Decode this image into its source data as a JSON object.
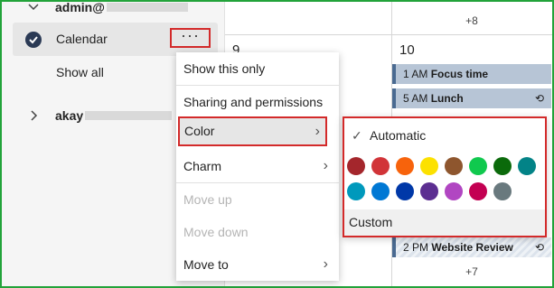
{
  "sidebar": {
    "account1": "admin@",
    "calendar_label": "Calendar",
    "more_label": "···",
    "show_all": "Show all",
    "account2": "akay"
  },
  "grid": {
    "more_top": "+8",
    "day_left": "9",
    "day_right": "10",
    "more_bottom": "+7",
    "events": [
      {
        "time": "1 AM",
        "title": "Focus time",
        "repeat": ""
      },
      {
        "time": "5 AM",
        "title": "Lunch",
        "repeat": "⟲"
      },
      {
        "time": "2 PM",
        "title": "Website Review",
        "repeat": "⟲"
      }
    ]
  },
  "menu": {
    "items": [
      "Show this only",
      "Sharing and permissions",
      "Color",
      "Charm",
      "Move up",
      "Move down",
      "Move to"
    ]
  },
  "submenu": {
    "automatic": "Automatic",
    "custom": "Custom",
    "swatches": [
      "#a4262c",
      "#d13438",
      "#f7630c",
      "#fce100",
      "#8e562e",
      "#10c94e",
      "#0b6a0b",
      "#038387",
      "#0099bc",
      "#0078d4",
      "#0038a8",
      "#5c2e91",
      "#b146c2",
      "#c30052",
      "#69797e"
    ]
  }
}
